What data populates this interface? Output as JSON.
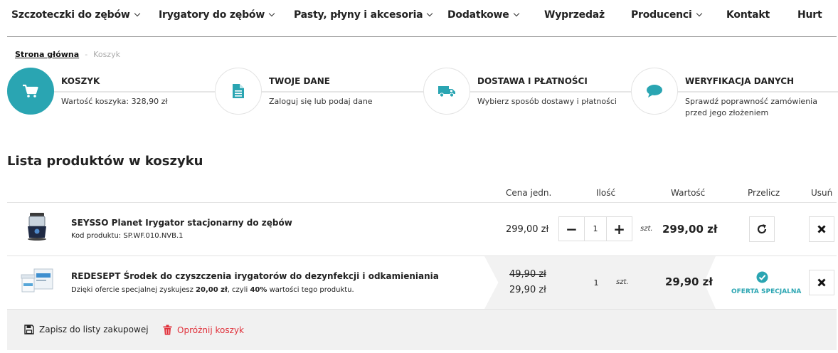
{
  "nav": {
    "items": [
      {
        "label": "Szczoteczki do zębów",
        "dropdown": true
      },
      {
        "label": "Irygatory do zębów",
        "dropdown": true
      },
      {
        "label": "Pasty, płyny i akcesoria",
        "dropdown": true
      },
      {
        "label": "Dodatkowe",
        "dropdown": true
      },
      {
        "label": "Wyprzedaż",
        "dropdown": false
      },
      {
        "label": "Producenci",
        "dropdown": true
      },
      {
        "label": "Kontakt",
        "dropdown": false
      },
      {
        "label": "Hurt",
        "dropdown": false
      }
    ]
  },
  "breadcrumb": {
    "home": "Strona główna",
    "separator": "-",
    "current": "Koszyk"
  },
  "steps": [
    {
      "title": "KOSZYK",
      "desc": "Wartość koszyka: 328,90 zł",
      "icon": "cart-icon",
      "active": true
    },
    {
      "title": "TWOJE DANE",
      "desc": "Zaloguj się lub podaj dane",
      "icon": "document-icon",
      "active": false
    },
    {
      "title": "DOSTAWA I PŁATNOŚCI",
      "desc": "Wybierz sposób dostawy i płatności",
      "icon": "truck-icon",
      "active": false
    },
    {
      "title": "WERYFIKACJA DANYCH",
      "desc": "Sprawdź poprawność zamówienia przed jego złożeniem",
      "icon": "chat-bubble-icon",
      "active": false
    }
  ],
  "section_title": "Lista produktów w koszyku",
  "table": {
    "headers": {
      "unit_price": "Cena jedn.",
      "quantity": "Ilość",
      "value": "Wartość",
      "recalc": "Przelicz",
      "remove": "Usuń"
    },
    "rows": [
      {
        "name": "SEYSSO Planet Irygator stacjonarny do zębów",
        "sub": "Kod produktu: SP.WF.010.NVB.1",
        "unit_price": "299,00 zł",
        "quantity": "1",
        "unit": "szt.",
        "value": "299,00 zł",
        "qty_minus": "−",
        "qty_plus": "+"
      },
      {
        "name": "REDESEPT Środek do czyszczenia irygatorów do dezynfekcji i odkamieniania",
        "sub_prefix": "Dzięki ofercie specjalnej zyskujesz ",
        "sub_amount": "20,00 zł",
        "sub_mid": ", czyli ",
        "sub_percent": "40%",
        "sub_suffix": " wartości tego produktu.",
        "old_price": "49,90 zł",
        "unit_price": "29,90 zł",
        "quantity": "1",
        "unit": "szt.",
        "value": "29,90 zł",
        "offer_label": "OFERTA SPECJALNA"
      }
    ]
  },
  "footer": {
    "save_list": "Zapisz do listy zakupowej",
    "clear_cart": "Opróżnij koszyk"
  },
  "colors": {
    "accent": "#2aa5b2",
    "danger": "#e0303a"
  }
}
